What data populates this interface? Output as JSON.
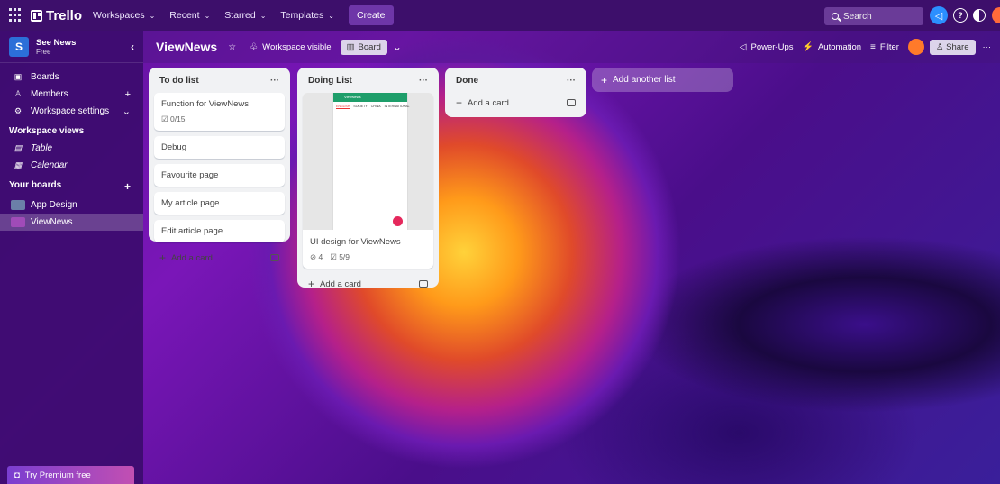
{
  "topbar": {
    "brand": "Trello",
    "menus": [
      "Workspaces",
      "Recent",
      "Starred",
      "Templates"
    ],
    "create_label": "Create",
    "search_placeholder": "Search"
  },
  "sidebar": {
    "workspace_initial": "S",
    "workspace_name": "See News",
    "workspace_plan": "Free",
    "items": [
      {
        "label": "Boards",
        "icon": "board-icon"
      },
      {
        "label": "Members",
        "icon": "members-icon"
      },
      {
        "label": "Workspace settings",
        "icon": "settings-icon"
      }
    ],
    "views_heading": "Workspace views",
    "views": [
      {
        "label": "Table",
        "icon": "table-icon"
      },
      {
        "label": "Calendar",
        "icon": "calendar-icon"
      }
    ],
    "boards_heading": "Your boards",
    "boards": [
      {
        "label": "App Design",
        "color": "#6b7fa8"
      },
      {
        "label": "ViewNews",
        "color": "#a04bb8"
      }
    ],
    "premium_label": "Try Premium free"
  },
  "board_header": {
    "title": "ViewNews",
    "visibility": "Workspace visible",
    "view_label": "Board",
    "powerups": "Power-Ups",
    "automation": "Automation",
    "filter": "Filter",
    "share": "Share"
  },
  "lists": [
    {
      "title": "To do list",
      "cards": [
        {
          "title": "Function for ViewNews",
          "checklist": "0/15"
        },
        {
          "title": "Debug"
        },
        {
          "title": "Favourite page"
        },
        {
          "title": "My article page"
        },
        {
          "title": "Edit article page"
        }
      ],
      "add_label": "Add a card"
    },
    {
      "title": "Doing List",
      "cards": [
        {
          "title": "UI design for ViewNews",
          "attachments": "4",
          "checklist": "5/9",
          "cover": {
            "app_name": "ViewNews",
            "tabs": [
              "ENGLISH",
              "SOCIETY",
              "CHINA",
              "INTERNATIONAL"
            ]
          }
        }
      ],
      "add_label": "Add a card"
    },
    {
      "title": "Done",
      "cards": [],
      "add_label": "Add a card"
    }
  ],
  "add_list_label": "Add another list",
  "colors": {
    "topbar": "#3d0f6b",
    "list_bg": "#f1f2f4",
    "workspace_avatar": "#2c6fd8"
  }
}
